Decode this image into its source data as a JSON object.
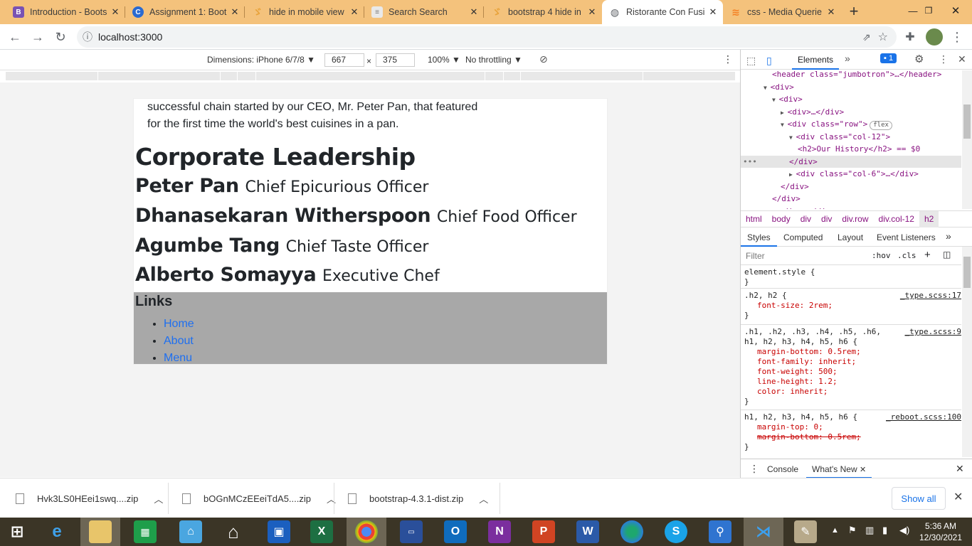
{
  "tabs": [
    {
      "title": "Introduction - Boots",
      "favicon": "B",
      "color": "#7952b3"
    },
    {
      "title": "Assignment 1: Boot",
      "favicon": "C",
      "color": "#2a6ad1"
    },
    {
      "title": "hide in mobile view",
      "favicon": "y",
      "color": "#e8a33b"
    },
    {
      "title": "Search Search",
      "favicon": "G",
      "color": "#777777"
    },
    {
      "title": "bootstrap 4 hide in",
      "favicon": "y",
      "color": "#e8a33b"
    },
    {
      "title": "Ristorante Con Fusi",
      "favicon": "globe",
      "color": "#5f6368"
    },
    {
      "title": "css - Media Querie",
      "favicon": "s",
      "color": "#f48024"
    }
  ],
  "toolbar": {
    "url": "localhost:3000"
  },
  "device_toolbar": {
    "dimensions_label": "Dimensions: iPhone 6/7/8",
    "width": "667",
    "times": "×",
    "height": "375",
    "zoom": "100%",
    "throttling": "No throttling"
  },
  "page": {
    "history_line1": "successful chain started by our CEO, Mr. Peter Pan, that featured",
    "history_line2": "for the first time the world's best cuisines in a pan.",
    "leadership_heading": "Corporate Leadership",
    "leaders": [
      {
        "name": "Peter Pan",
        "role": "Chief Epicurious Officer"
      },
      {
        "name": "Dhanasekaran Witherspoon",
        "role": "Chief Food Officer"
      },
      {
        "name": "Agumbe Tang",
        "role": "Chief Taste Officer"
      },
      {
        "name": "Alberto Somayya",
        "role": "Executive Chef"
      }
    ],
    "links_heading": "Links",
    "links": [
      "Home",
      "About",
      "Menu"
    ]
  },
  "devtools": {
    "elements_tab": "Elements",
    "issues_count": "1",
    "dom_lines": [
      {
        "indent": 3,
        "html": "<header class=\"jumbotron\">…</header>"
      },
      {
        "indent": 2,
        "arrow": "▼",
        "html": "<div>"
      },
      {
        "indent": 3,
        "arrow": "▼",
        "html": "<div>"
      },
      {
        "indent": 4,
        "arrow": "▶",
        "html": "<div>…</div>"
      },
      {
        "indent": 4,
        "arrow": "▼",
        "html": "<div class=\"row\">"
      },
      {
        "indent": 5,
        "arrow": "▼",
        "html": "<div class=\"col-12\">"
      },
      {
        "indent": 6,
        "html": "<h2>Our History</h2> == $0"
      },
      {
        "indent": 5,
        "html": "</div>"
      },
      {
        "indent": 5,
        "arrow": "▶",
        "html": "<div class=\"col-6\">…</div>"
      },
      {
        "indent": 4,
        "html": "</div>"
      },
      {
        "indent": 3,
        "html": "</div>"
      },
      {
        "indent": 3,
        "arrow": "▶",
        "html": "<div>…</div>"
      }
    ],
    "flex_badge": "flex",
    "breadcrumbs": [
      "html",
      "body",
      "div",
      "div",
      "div.row",
      "div.col-12",
      "h2"
    ],
    "subtabs": [
      "Styles",
      "Computed",
      "Layout",
      "Event Listeners"
    ],
    "filter_placeholder": "Filter",
    "hov": ":hov",
    "cls": ".cls",
    "css_rules": [
      {
        "selector": "element.style {",
        "source": "",
        "props": []
      },
      {
        "selector": ".h2, h2 {",
        "source": "_type.scss:17",
        "props": [
          "font-size: 2rem;"
        ]
      },
      {
        "selector": ".h1, .h2, .h3, .h4, .h5, .h6,",
        "selector2": "h1, h2, h3, h4, h5, h6 {",
        "source": "_type.scss:9",
        "props": [
          "margin-bottom: 0.5rem;",
          "font-family: inherit;",
          "font-weight: 500;",
          "line-height: 1.2;",
          "color: inherit;"
        ]
      },
      {
        "selector": "h1, h2, h3, h4, h5, h6 {",
        "source": "_reboot.scss:100",
        "props": [
          "margin-top: 0;",
          "margin-bottom: 0.5rem;"
        ]
      }
    ],
    "drawer_tabs": [
      "Console",
      "What's New"
    ]
  },
  "downloads": [
    {
      "name": "Hvk3LS0HEei1swq....zip"
    },
    {
      "name": "bOGnMCzEEeiTdA5....zip"
    },
    {
      "name": "bootstrap-4.3.1-dist.zip"
    }
  ],
  "show_all": "Show all",
  "taskbar": {
    "time": "5:36 AM",
    "date": "12/30/2021"
  }
}
